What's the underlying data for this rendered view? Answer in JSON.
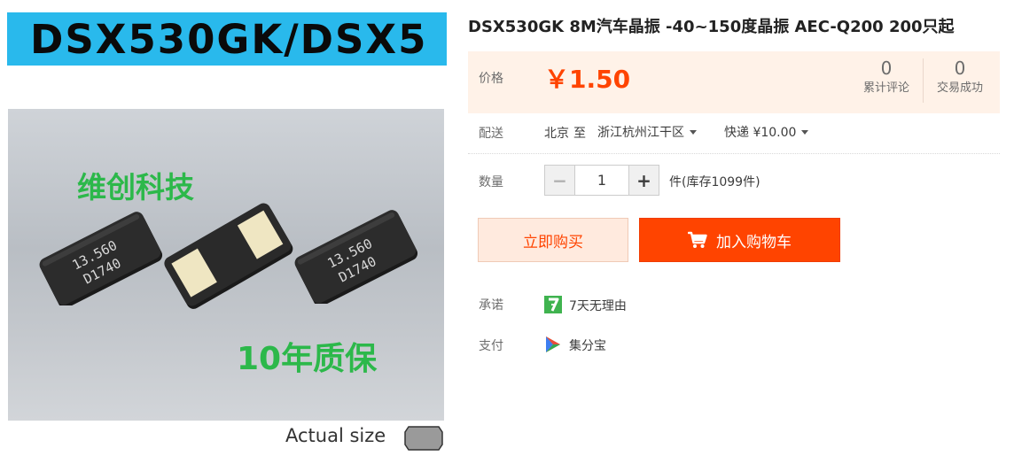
{
  "product_image": {
    "banner_text": "DSX530GK/DSX5",
    "overlay_brand": "维创科技",
    "overlay_warranty": "10年质保",
    "chip_marking_line1": "13.560",
    "chip_marking_line2": "D1740",
    "actual_size_label": "Actual size"
  },
  "product": {
    "title": "DSX530GK 8M汽车晶振 -40~150度晶振 AEC-Q200 200只起"
  },
  "price": {
    "label": "价格",
    "value": "￥1.50",
    "reviews_count": "0",
    "reviews_label": "累计评论",
    "deals_count": "0",
    "deals_label": "交易成功"
  },
  "shipping": {
    "label": "配送",
    "from": "北京",
    "to_word": "至",
    "destination": "浙江杭州江干区",
    "method": "快递 ¥10.00"
  },
  "quantity": {
    "label": "数量",
    "minus": "−",
    "value": "1",
    "plus": "+",
    "stock_text": "件(库存1099件)"
  },
  "actions": {
    "buy_now": "立即购买",
    "add_to_cart": "加入购物车"
  },
  "promise": {
    "label": "承诺",
    "text": "7天无理由"
  },
  "payment": {
    "label": "支付",
    "text": "集分宝"
  },
  "colors": {
    "accent": "#ff4400",
    "price_bg": "#fff2e8",
    "buy_bg": "#ffeade",
    "banner_bg": "#29b9ec",
    "overlay_green": "#2cb84a"
  },
  "icons": {
    "cart": "cart-icon",
    "promise": "seven-day-icon",
    "payment": "jifenbao-icon",
    "dest_caret": "chevron-down-icon",
    "method_caret": "chevron-down-icon"
  }
}
